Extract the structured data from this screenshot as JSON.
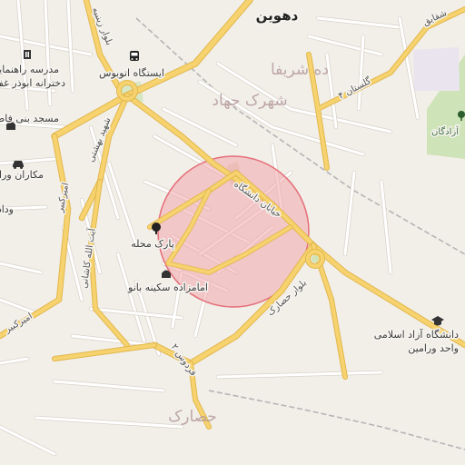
{
  "labels": {
    "dehvin": "دهوین",
    "deh_sharifa": "ده شریفا",
    "shahrak_jahad": "شهرک جهاد",
    "golestan_4": "گلستان ۴",
    "shaghayegh": "شقایق",
    "azadegan": "آزادگان",
    "bus_station": "ایستگاه اتوبوس",
    "boulevard_zeynab": "بلوار زینبیه",
    "school_line1": "مدرسه راهنمایی",
    "school_line2": "دخترانه ابوذر غفاری",
    "mosque": "مسجد بنی فاطمه",
    "mechanic": "مکاران ورامین",
    "vada": "وداد",
    "shahid_beheshti": "شهید بهشتی",
    "ayatollah_kashani": "آیت الله کاشانی",
    "amirkabir_1": "امیرکبیر",
    "amirkabir_2": "امیرکبیر",
    "khiaban_daneshgah": "خیابان دانشگاه",
    "park_mahalleh": "پارک محله",
    "imamzadeh": "امامزاده سکینه بانو",
    "boulevard_hesarak": "بلوار حصارک",
    "university_line1": "دانشگاه آزاد اسلامی",
    "university_line2": "واحد ورامین",
    "ferdows_2": "فردوس ۲",
    "hesarak": "حصارک"
  },
  "icons": {
    "bus": "bus-icon",
    "school": "school-icon",
    "mosque": "mosque-icon",
    "car": "car-icon",
    "park": "tree-icon",
    "shrine": "shrine-icon",
    "university": "graduation-cap-icon",
    "green_area": "park-icon"
  },
  "colors": {
    "background": "#f2efe9",
    "major_road": "#f6d36e",
    "minor_road": "#ffffff",
    "highlight_circle_fill": "#f3a6ab",
    "highlight_circle_stroke": "#e46f79",
    "green": "#cfe3b8"
  }
}
